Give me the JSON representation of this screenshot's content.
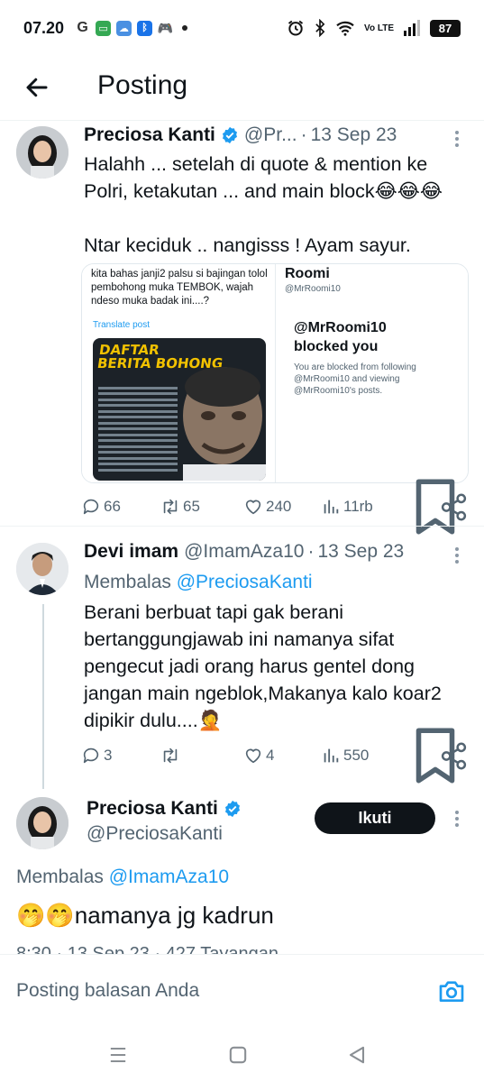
{
  "status_bar": {
    "time": "07.20",
    "battery": "87",
    "network": "Vo LTE"
  },
  "header": {
    "title": "Posting"
  },
  "tweets": [
    {
      "name": "Preciosa Kanti",
      "handle": "@Pr...",
      "date": "13 Sep 23",
      "text_line1": "Halahh ... setelah di quote & mention ke",
      "text_line2": "Polri, ketakutan ... and main block😂😂😂",
      "text_line3": "Ntar keciduk .. nangisss ! Ayam sayur.",
      "media": {
        "left_text": "kita bahas janji2 palsu si bajingan tolol pembohong muka TEMBOK, wajah ndeso muka badak ini....?",
        "translate": "Translate post",
        "poster_title_1": "DAFTAR",
        "poster_title_2": "BERITA BOHONG",
        "right_name": "Roomi",
        "right_handle": "@MrRoomi10",
        "blocked_1": "@MrRoomi10",
        "blocked_2": "blocked you",
        "blocked_desc": "You are blocked from following @MrRoomi10 and viewing @MrRoomi10's posts."
      },
      "stats": {
        "replies": "66",
        "reposts": "65",
        "likes": "240",
        "views": "11rb"
      }
    },
    {
      "name": "Devi imam",
      "handle": "@ImamAza10",
      "date": "13 Sep 23",
      "reply_prefix": "Membalas ",
      "reply_to": "@PreciosaKanti",
      "text_lines": [
        "Berani berbuat tapi gak berani",
        "bertanggungjawab ini namanya sifat",
        "pengecut jadi orang harus gentel dong",
        "jangan main ngeblok,Makanya kalo koar2",
        "dipikir dulu....🤦"
      ],
      "stats": {
        "replies": "3",
        "reposts": "",
        "likes": "4",
        "views": "550"
      }
    },
    {
      "name": "Preciosa Kanti",
      "handle": "@PreciosaKanti",
      "follow_label": "Ikuti",
      "reply_prefix": "Membalas ",
      "reply_to": "@ImamAza10",
      "text": "🤭🤭namanya jg kadrun",
      "meta": "8:30 · 13 Sep 23 · 427 Tayangan"
    }
  ],
  "reply_bar": {
    "placeholder": "Posting balasan Anda"
  },
  "colors": {
    "accent": "#1d9bf0",
    "text": "#0f1419",
    "muted": "#536471"
  }
}
